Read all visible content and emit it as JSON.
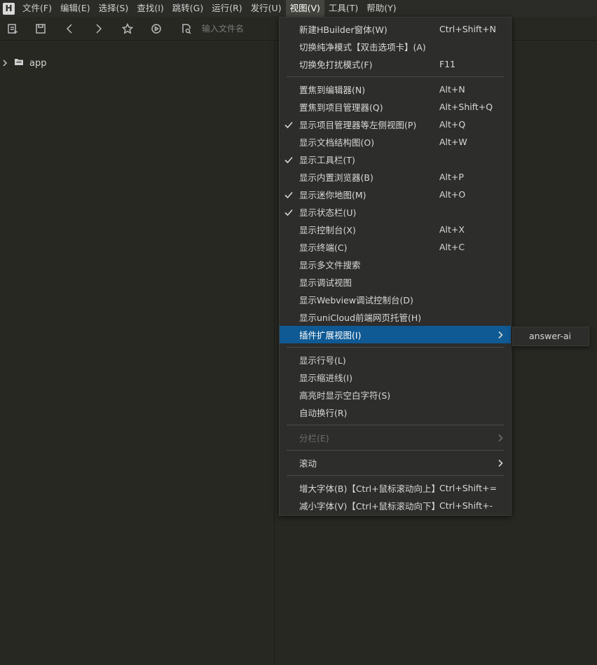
{
  "menubar": {
    "logo": "H",
    "items": [
      "文件(F)",
      "编辑(E)",
      "选择(S)",
      "查找(I)",
      "跳转(G)",
      "运行(R)",
      "发行(U)",
      "视图(V)",
      "工具(T)",
      "帮助(Y)"
    ],
    "active_index": 7
  },
  "toolbar": {
    "icons": [
      "new-file-icon",
      "save-icon",
      "back-icon",
      "forward-icon",
      "star-icon",
      "run-icon",
      "search-file-icon"
    ],
    "file_input_placeholder": "输入文件名"
  },
  "project_tree": {
    "items": [
      {
        "label": "app",
        "expanded": false
      }
    ]
  },
  "view_menu": {
    "items": [
      {
        "label": "新建HBuilder窗体(W)",
        "shortcut": "Ctrl+Shift+N"
      },
      {
        "label": "切换纯净模式【双击选项卡】(A)",
        "shortcut": ""
      },
      {
        "label": "切换免打扰模式(F)",
        "shortcut": "F11"
      },
      {
        "label": "置焦到编辑器(N)",
        "shortcut": "Alt+N"
      },
      {
        "label": "置焦到项目管理器(Q)",
        "shortcut": "Alt+Shift+Q"
      },
      {
        "label": "显示项目管理器等左侧视图(P)",
        "shortcut": "Alt+Q",
        "checked": true
      },
      {
        "label": "显示文档结构图(O)",
        "shortcut": "Alt+W"
      },
      {
        "label": "显示工具栏(T)",
        "shortcut": "",
        "checked": true
      },
      {
        "label": "显示内置浏览器(B)",
        "shortcut": "Alt+P"
      },
      {
        "label": "显示迷你地图(M)",
        "shortcut": "Alt+O",
        "checked": true
      },
      {
        "label": "显示状态栏(U)",
        "shortcut": "",
        "checked": true
      },
      {
        "label": "显示控制台(X)",
        "shortcut": "Alt+X"
      },
      {
        "label": "显示终端(C)",
        "shortcut": "Alt+C"
      },
      {
        "label": "显示多文件搜索",
        "shortcut": ""
      },
      {
        "label": "显示调试视图",
        "shortcut": ""
      },
      {
        "label": "显示Webview调试控制台(D)",
        "shortcut": ""
      },
      {
        "label": "显示uniCloud前端网页托管(H)",
        "shortcut": ""
      },
      {
        "label": "插件扩展视图(I)",
        "shortcut": "",
        "submenu": true,
        "highlighted": true
      },
      {
        "label": "显示行号(L)",
        "shortcut": ""
      },
      {
        "label": "显示缩进线(I)",
        "shortcut": ""
      },
      {
        "label": "高亮时显示空白字符(S)",
        "shortcut": ""
      },
      {
        "label": "自动换行(R)",
        "shortcut": ""
      },
      {
        "label": "分栏(E)",
        "shortcut": "",
        "submenu": true,
        "disabled": true
      },
      {
        "label": "滚动",
        "shortcut": "",
        "submenu": true
      },
      {
        "label": "增大字体(B)【Ctrl+鼠标滚动向上】",
        "shortcut": "Ctrl+Shift+="
      },
      {
        "label": "减小字体(V)【Ctrl+鼠标滚动向下】",
        "shortcut": "Ctrl+Shift+-"
      }
    ]
  },
  "plugin_submenu": {
    "items": [
      "answer-ai"
    ]
  },
  "colors": {
    "background": "#272822",
    "menu_background": "#2d2d2b",
    "highlight": "#0f5a94"
  }
}
